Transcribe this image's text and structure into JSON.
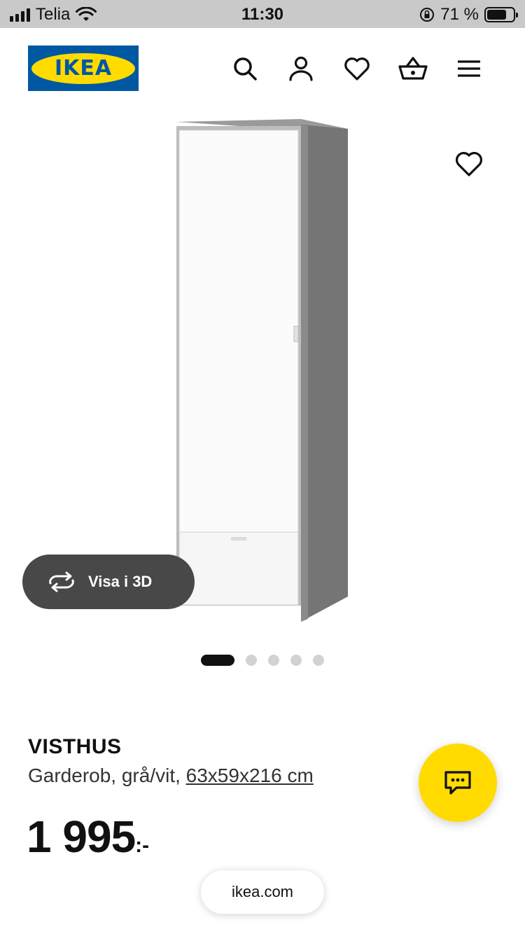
{
  "status_bar": {
    "carrier": "Telia",
    "time": "11:30",
    "battery": "71 %"
  },
  "header": {
    "logo_text": "IKEA",
    "icons": [
      "search-icon",
      "profile-icon",
      "heart-icon",
      "basket-icon",
      "menu-icon"
    ]
  },
  "gallery": {
    "view_3d_label": "Visa i 3D",
    "image_count": 5,
    "active_index": 0
  },
  "product": {
    "name": "VISTHUS",
    "description": "Garderob, grå/vit,",
    "dimensions": "63x59x216 cm",
    "price": "1 995",
    "price_suffix": ":-"
  },
  "browser": {
    "url": "ikea.com"
  },
  "colors": {
    "ikea_blue": "#0058a3",
    "ikea_yellow": "#ffdb00",
    "pill_dark": "#484848"
  }
}
